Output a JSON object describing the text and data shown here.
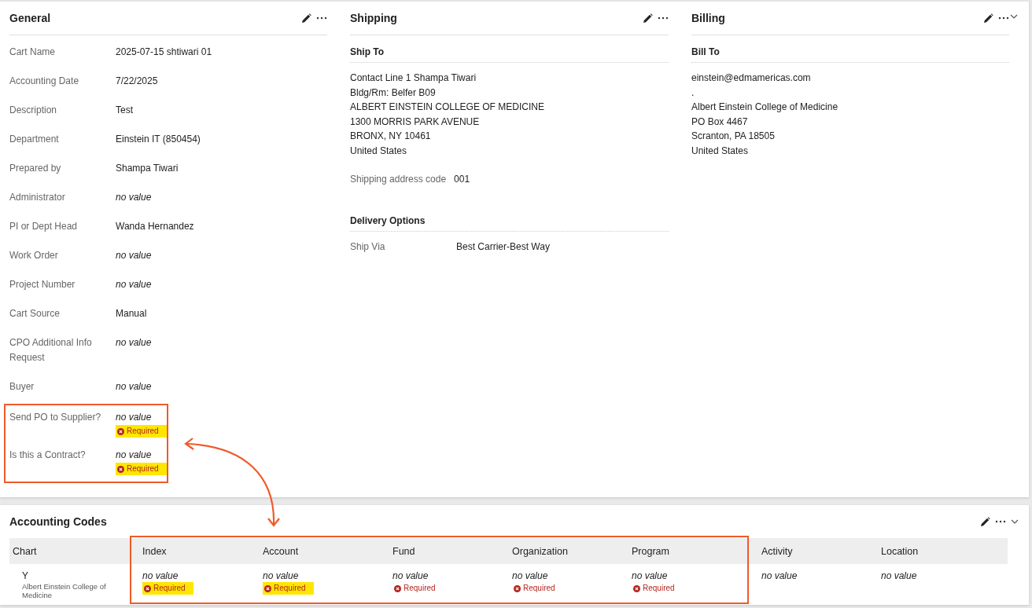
{
  "general": {
    "title": "General",
    "fields": [
      {
        "label": "Cart Name",
        "value": "2025-07-15 shtiwari 01",
        "empty": false
      },
      {
        "label": "Accounting Date",
        "value": "7/22/2025",
        "empty": false
      },
      {
        "label": "Description",
        "value": "Test",
        "empty": false
      },
      {
        "label": "Department",
        "value": "Einstein IT (850454)",
        "empty": false
      },
      {
        "label": "Prepared by",
        "value": "Shampa Tiwari",
        "empty": false
      },
      {
        "label": "Administrator",
        "value": "no value",
        "empty": true
      },
      {
        "label": "PI or Dept Head",
        "value": "Wanda Hernandez",
        "empty": false
      },
      {
        "label": "Work Order",
        "value": "no value",
        "empty": true
      },
      {
        "label": "Project Number",
        "value": "no value",
        "empty": true
      },
      {
        "label": "Cart Source",
        "value": "Manual",
        "empty": false
      },
      {
        "label": "CPO Additional Info Request",
        "value": "no value",
        "empty": true
      },
      {
        "label": "Buyer",
        "value": "no value",
        "empty": true
      }
    ],
    "callout_fields": [
      {
        "label": "Send PO to Supplier?",
        "value": "no value",
        "empty": true,
        "flag": {
          "text": "Required",
          "highlighted": true
        }
      },
      {
        "label": "Is this a Contract?",
        "value": "no value",
        "empty": true,
        "flag": {
          "text": "Required",
          "highlighted": true
        }
      }
    ]
  },
  "shipping": {
    "title": "Shipping",
    "ship_to": {
      "heading": "Ship To",
      "lines": [
        "Contact Line 1 Shampa Tiwari",
        "Bldg/Rm: Belfer B09",
        "ALBERT EINSTEIN COLLEGE OF MEDICINE",
        "1300 MORRIS PARK AVENUE",
        "BRONX, NY 10461",
        "United States"
      ]
    },
    "address_code": {
      "label": "Shipping address code",
      "value": "001"
    },
    "delivery": {
      "heading": "Delivery Options",
      "label": "Ship Via",
      "value": "Best Carrier-Best Way"
    }
  },
  "billing": {
    "title": "Billing",
    "bill_to": {
      "heading": "Bill To",
      "lines": [
        "einstein@edmamericas.com",
        ".",
        "Albert Einstein College of Medicine",
        "PO Box 4467",
        "Scranton, PA 18505",
        "United States"
      ]
    }
  },
  "callout_arrow": true,
  "accounting_codes": {
    "title": "Accounting Codes",
    "column_groups": [
      {
        "outlined": false,
        "columns": [
          "Chart"
        ]
      },
      {
        "outlined": true,
        "columns": [
          "Index",
          "Account",
          "Fund",
          "Organization",
          "Program"
        ]
      },
      {
        "outlined": false,
        "columns": [
          "Activity",
          "Location"
        ]
      }
    ],
    "rows": [
      {
        "cells": [
          {
            "value": "Y",
            "empty": false,
            "note": "Albert Einstein College of Medicine"
          },
          {
            "value": "no value",
            "empty": true,
            "flag": {
              "text": "Required",
              "highlighted": true
            }
          },
          {
            "value": "no value",
            "empty": true,
            "flag": {
              "text": "Required",
              "highlighted": true
            }
          },
          {
            "value": "no value",
            "empty": true,
            "flag": {
              "text": "Required",
              "highlighted": false
            }
          },
          {
            "value": "no value",
            "empty": true,
            "flag": {
              "text": "Required",
              "highlighted": false
            }
          },
          {
            "value": "no value",
            "empty": true,
            "flag": {
              "text": "Required",
              "highlighted": false
            }
          },
          {
            "value": "no value",
            "empty": true
          },
          {
            "value": "no value",
            "empty": true
          }
        ]
      }
    ]
  }
}
